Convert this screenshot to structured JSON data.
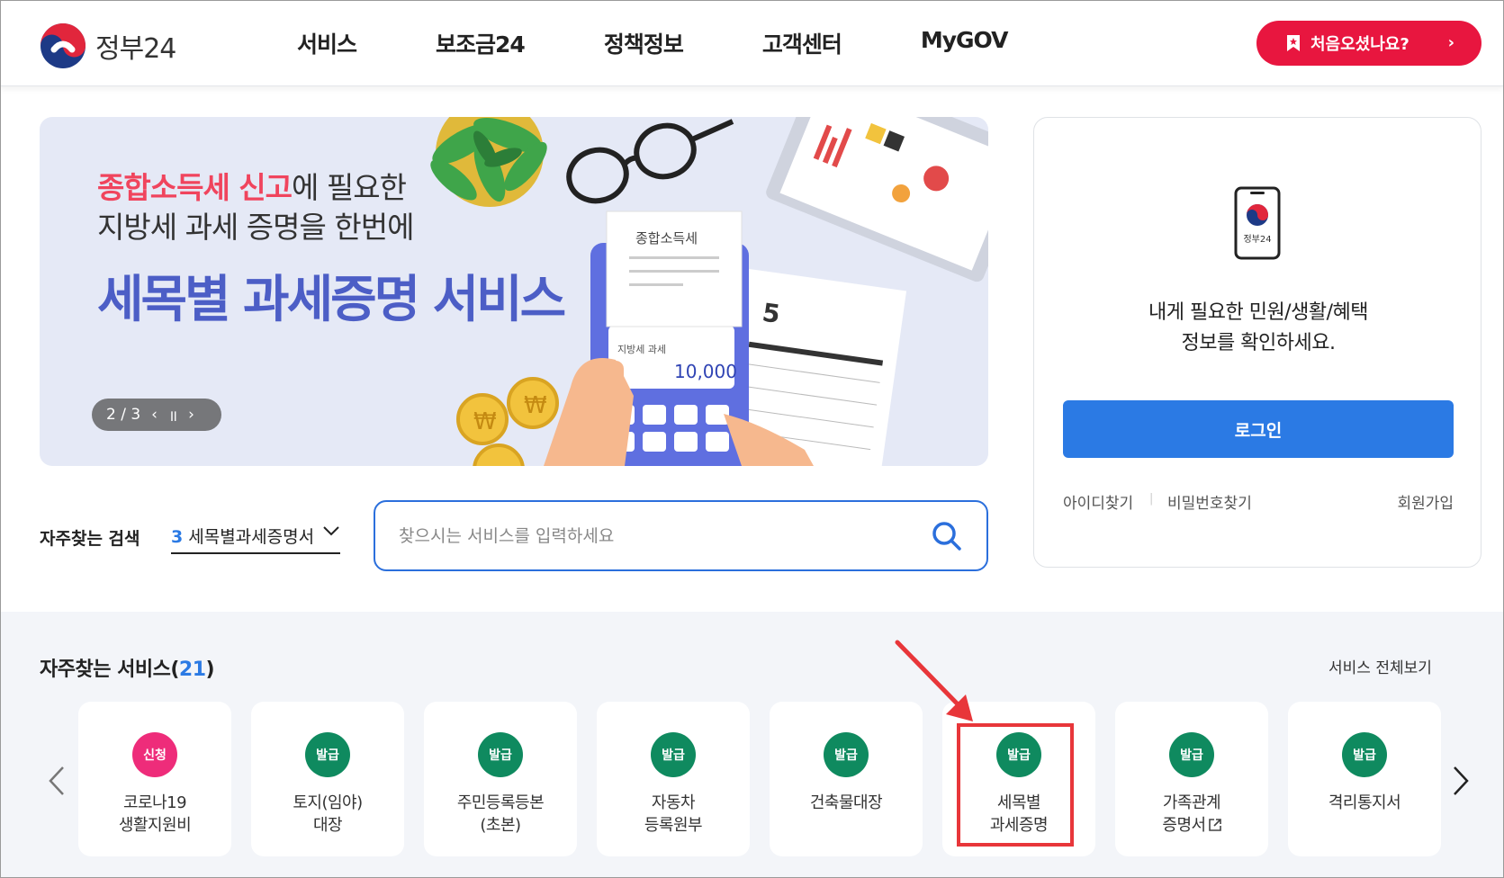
{
  "header": {
    "logo_text": "정부24",
    "nav": [
      "서비스",
      "보조금24",
      "정책정보",
      "고객센터",
      "MyGOV"
    ],
    "cta_label": "처음오셨나요?"
  },
  "banner": {
    "line1_highlight": "종합소득세 신고",
    "line1_rest": "에 필요한",
    "line2": "지방세 과세 증명을 한번에",
    "line3": "세목별 과세증명 서비스",
    "receipt_title": "종합소득세",
    "screen_label": "지방세 과세",
    "screen_value": "10,000",
    "calendar_day": "5",
    "pager": "2 / 3"
  },
  "login": {
    "app_label": "정부24",
    "message_line1": "내게 필요한 민원/생활/혜택",
    "message_line2": "정보를 확인하세요.",
    "button": "로그인",
    "find_id": "아이디찾기",
    "find_pw": "비밀번호찾기",
    "signup": "회원가입"
  },
  "search": {
    "freq_label": "자주찾는 검색",
    "freq_rank": "3",
    "freq_value": "세목별과세증명서",
    "placeholder": "찾으시는 서비스를 입력하세요"
  },
  "services": {
    "title": "자주찾는 서비스(",
    "count": "21",
    "title_end": ")",
    "view_all": "서비스 전체보기",
    "items": [
      {
        "badge": "신청",
        "line1": "코로나19",
        "line2": "생활지원비",
        "color": "#ee2c7a"
      },
      {
        "badge": "발급",
        "line1": "토지(임야)",
        "line2": "대장",
        "color": "#0f8a5f"
      },
      {
        "badge": "발급",
        "line1": "주민등록등본",
        "line2": "(초본)",
        "color": "#0f8a5f"
      },
      {
        "badge": "발급",
        "line1": "자동차",
        "line2": "등록원부",
        "color": "#0f8a5f"
      },
      {
        "badge": "발급",
        "line1": "건축물대장",
        "line2": "",
        "color": "#0f8a5f"
      },
      {
        "badge": "발급",
        "line1": "세목별",
        "line2": "과세증명",
        "color": "#0f8a5f"
      },
      {
        "badge": "발급",
        "line1": "가족관계",
        "line2": "증명서",
        "color": "#0f8a5f"
      },
      {
        "badge": "발급",
        "line1": "격리통지서",
        "line2": "",
        "color": "#0f8a5f"
      }
    ]
  },
  "colors": {
    "brand_red": "#e8163f",
    "primary_blue": "#2b7ae4",
    "banner_title": "#4c5ec6",
    "annotation": "#e8363a"
  }
}
